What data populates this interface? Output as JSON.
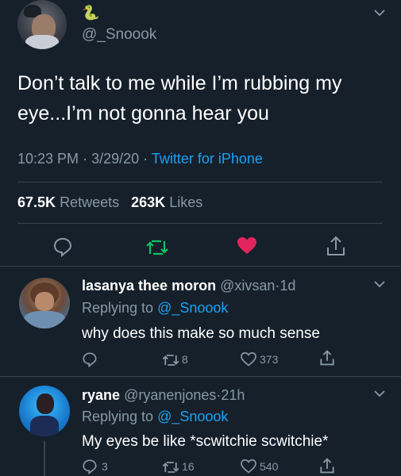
{
  "main_tweet": {
    "display_emoji": "🐍",
    "handle": "@_Snoook",
    "text_line1": "Don’t talk to me while I’m rubbing my",
    "text_line2": "eye...I’m not gonna hear you",
    "time": "10:23 PM",
    "date": "3/29/20",
    "dot": "·",
    "source": "Twitter for iPhone",
    "retweets_count": "67.5K",
    "retweets_label": "Retweets",
    "likes_count": "263K",
    "likes_label": "Likes"
  },
  "replies": [
    {
      "name": "lasanya thee moron",
      "handle": "@xivsan",
      "dot": "·",
      "age": "1d",
      "replying_label": "Replying to",
      "replying_handle": "@_Snoook",
      "text": "why does this make so much sense",
      "reply_count": "",
      "retweet_count": "8",
      "like_count": "373"
    },
    {
      "name": "ryane",
      "handle": "@ryanenjones",
      "dot": "·",
      "age": "21h",
      "replying_label": "Replying to",
      "replying_handle": "@_Snoook",
      "text": "My eyes be like *scwitchie scwitchie*",
      "reply_count": "3",
      "retweet_count": "16",
      "like_count": "540"
    }
  ],
  "colors": {
    "background": "#15202b",
    "accent": "#1da1f2",
    "retweet": "#17bf63",
    "like": "#e0245e",
    "muted": "#8899a6"
  }
}
